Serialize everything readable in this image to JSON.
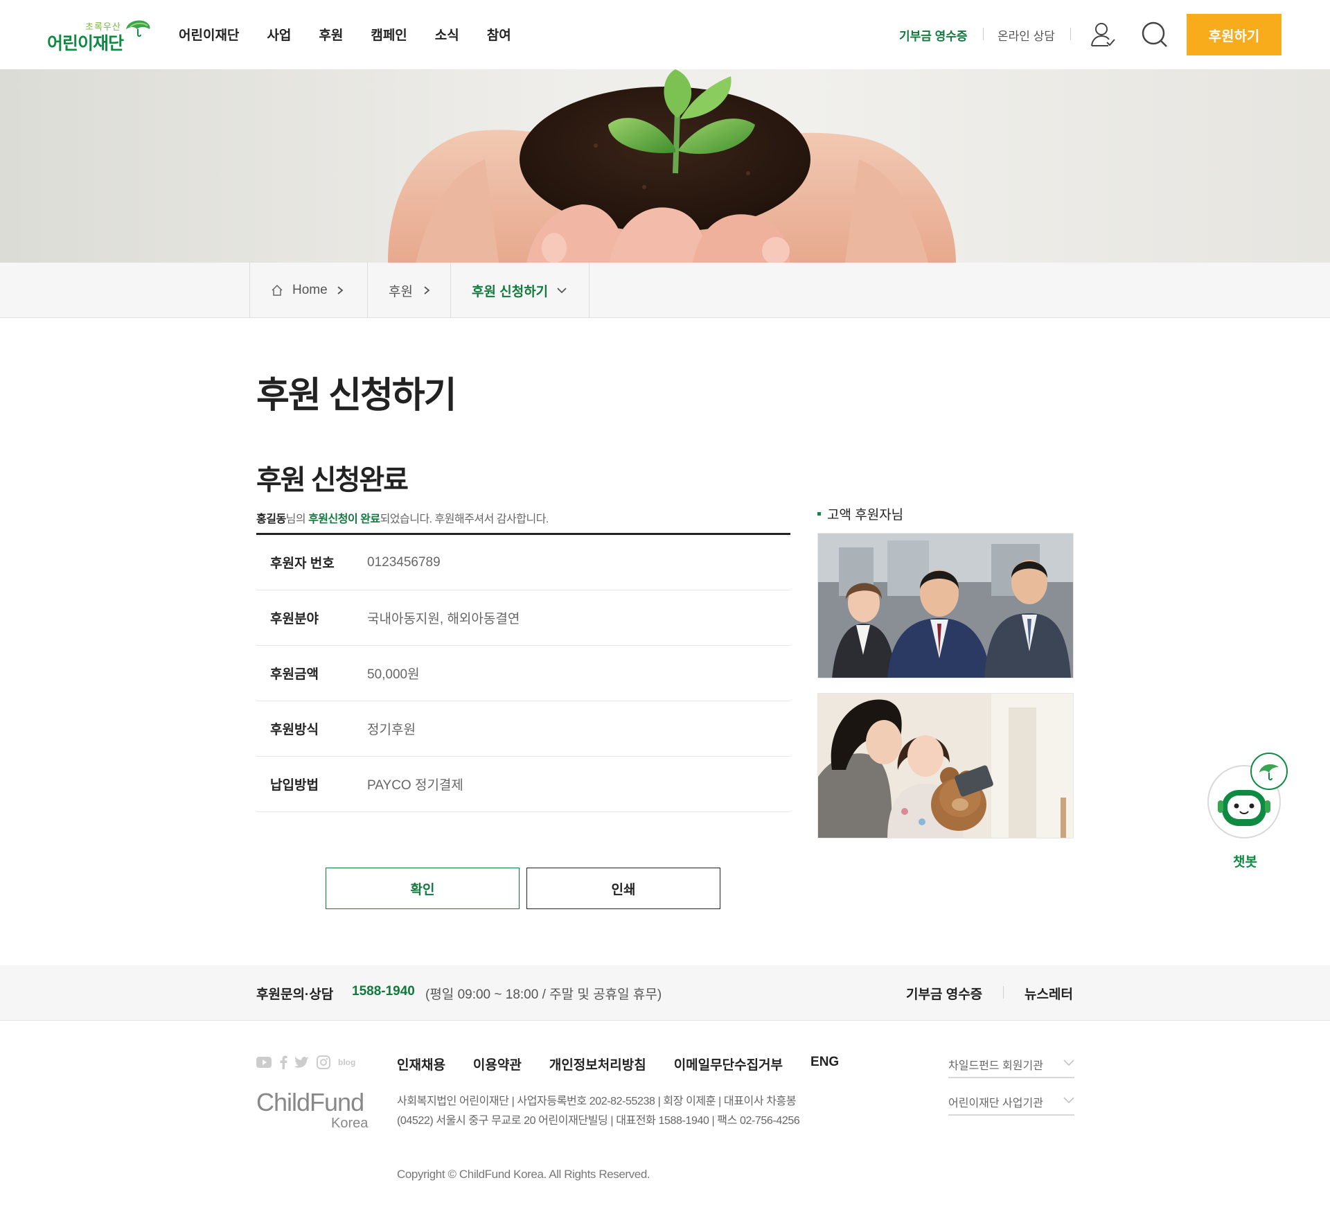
{
  "header": {
    "logo_sub": "초록우산",
    "logo_main": "어린이재단",
    "nav": [
      "어린이재단",
      "사업",
      "후원",
      "캠페인",
      "소식",
      "참여"
    ],
    "util_receipt": "기부금 영수증",
    "util_consult": "온라인 상담",
    "donate_label": "후원하기"
  },
  "breadcrumb": {
    "home": "Home",
    "level1": "후원",
    "level2": "후원 신청하기"
  },
  "main": {
    "page_title": "후원 신청하기",
    "section_title": "후원 신청완료",
    "thanks_name": "홍길동",
    "thanks_mid": "님의 ",
    "thanks_highlight": "후원신청이 완료",
    "thanks_tail": "되었습니다. 후원해주셔서 감사합니다.",
    "rows": [
      {
        "label": "후원자 번호",
        "value": "0123456789"
      },
      {
        "label": "후원분야",
        "value": "국내아동지원, 해외아동결연"
      },
      {
        "label": "후원금액",
        "value": "50,000원"
      },
      {
        "label": "후원방식",
        "value": "정기후원"
      },
      {
        "label": "납입방법",
        "value": "PAYCO 정기결제"
      }
    ],
    "confirm_label": "확인",
    "print_label": "인쇄"
  },
  "side": {
    "title": "고액 후원자님"
  },
  "chatbot": {
    "label": "챗봇"
  },
  "contact": {
    "label": "후원문의·상담",
    "phone": "1588-1940",
    "hours": "(평일 09:00 ~ 18:00 / 주말 및 공휴일 휴무)",
    "receipt_link": "기부금 영수증",
    "newsletter_link": "뉴스레터"
  },
  "footer": {
    "sns_blog": "blog",
    "logo_word": "ChildFund",
    "logo_korea": "Korea",
    "links": [
      "인재채용",
      "이용약관",
      "개인정보처리방침",
      "이메일무단수집거부",
      "ENG"
    ],
    "address_line1": "사회복지법인 어린이재단 | 사업자등록번호 202-82-55238 | 회장 이제훈 | 대표이사 차흥봉",
    "address_line2": "(04522) 서울시 중구 무교로 20 어린이재단빌딩 | 대표전화 1588-1940 | 팩스 02-756-4256",
    "copyright": "Copyright © ChildFund Korea. All Rights Reserved.",
    "select1": "차일드펀드 회원기관",
    "select2": "어린이재단 사업기관"
  },
  "colors": {
    "brand_green": "#0f7a3c",
    "accent_orange": "#f8ac1c"
  }
}
